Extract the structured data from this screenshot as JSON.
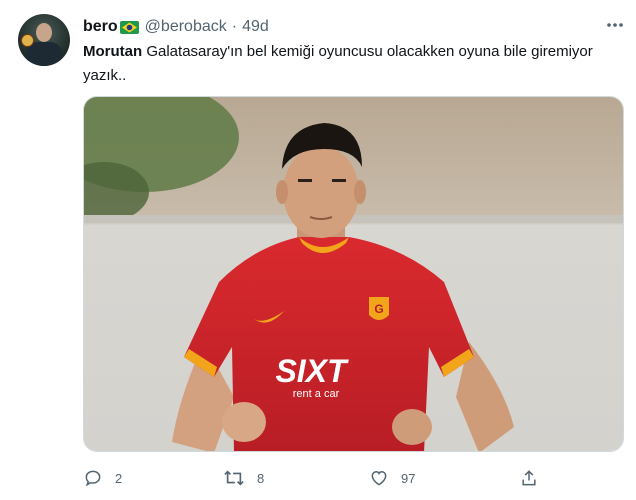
{
  "tweet": {
    "author_name": "bero",
    "author_flag": "brazil-flag-emoji",
    "handle": "@beroback",
    "separator": "·",
    "time": "49d",
    "text_bold": "Morutan",
    "text_rest": " Galatasaray'ın bel kemiği oyuncusu olacakken oyuna bile giremiyor yazık..",
    "media": {
      "description_icon": "photo-football-player",
      "jersey_sponsor": "SIXT",
      "jersey_sponsor_sub": "rent a car"
    },
    "actions": {
      "reply_count": "2",
      "retweet_count": "8",
      "like_count": "97"
    }
  },
  "colors": {
    "text": "#0f1419",
    "secondary": "#536471",
    "border": "#cfd9de",
    "jersey_red": "#c8202a",
    "jersey_gold": "#f2a41b"
  },
  "icons": [
    "more-icon",
    "reply-icon",
    "retweet-icon",
    "like-icon",
    "share-icon"
  ]
}
